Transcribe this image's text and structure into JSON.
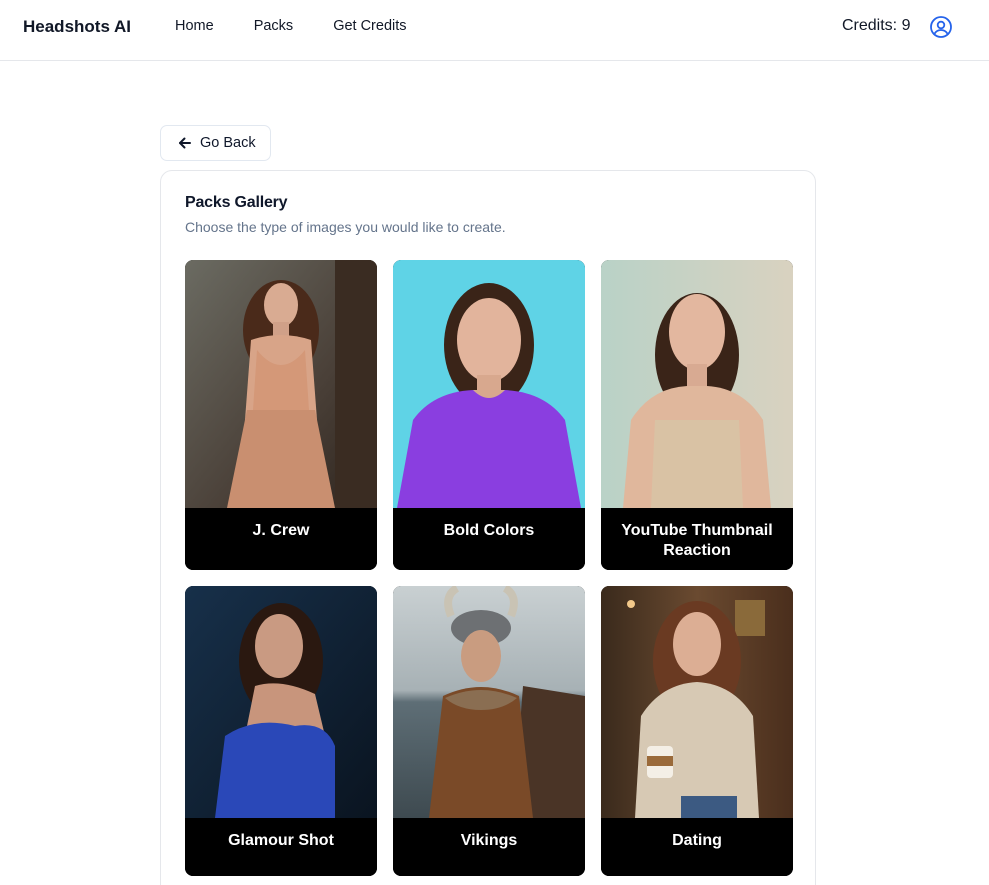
{
  "nav": {
    "brand": "Headshots AI",
    "links": [
      "Home",
      "Packs",
      "Get Credits"
    ],
    "credits": "Credits: 9"
  },
  "back_button": {
    "label": "Go Back"
  },
  "gallery": {
    "title": "Packs Gallery",
    "subtitle": "Choose the type of images you would like to create.",
    "packs": [
      {
        "label": "J. Crew"
      },
      {
        "label": "Bold Colors"
      },
      {
        "label": "YouTube Thumbnail Reaction"
      },
      {
        "label": "Glamour Shot"
      },
      {
        "label": "Vikings"
      },
      {
        "label": "Dating"
      }
    ]
  },
  "colors": {
    "border": "#e5e7eb",
    "subtext": "#64748b",
    "label_bg": "#000000",
    "icon_blue": "#2563eb"
  }
}
